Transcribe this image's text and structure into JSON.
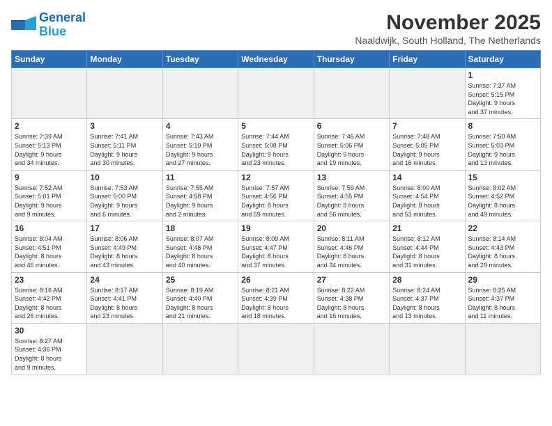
{
  "logo": {
    "line1": "General",
    "line2": "Blue"
  },
  "title": "November 2025",
  "subtitle": "Naaldwijk, South Holland, The Netherlands",
  "days_header": [
    "Sunday",
    "Monday",
    "Tuesday",
    "Wednesday",
    "Thursday",
    "Friday",
    "Saturday"
  ],
  "weeks": [
    [
      {
        "day": "",
        "info": "",
        "empty": true
      },
      {
        "day": "",
        "info": "",
        "empty": true
      },
      {
        "day": "",
        "info": "",
        "empty": true
      },
      {
        "day": "",
        "info": "",
        "empty": true
      },
      {
        "day": "",
        "info": "",
        "empty": true
      },
      {
        "day": "",
        "info": "",
        "empty": true
      },
      {
        "day": "1",
        "info": "Sunrise: 7:37 AM\nSunset: 5:15 PM\nDaylight: 9 hours\nand 37 minutes."
      }
    ],
    [
      {
        "day": "2",
        "info": "Sunrise: 7:39 AM\nSunset: 5:13 PM\nDaylight: 9 hours\nand 34 minutes."
      },
      {
        "day": "3",
        "info": "Sunrise: 7:41 AM\nSunset: 5:11 PM\nDaylight: 9 hours\nand 30 minutes."
      },
      {
        "day": "4",
        "info": "Sunrise: 7:43 AM\nSunset: 5:10 PM\nDaylight: 9 hours\nand 27 minutes."
      },
      {
        "day": "5",
        "info": "Sunrise: 7:44 AM\nSunset: 5:08 PM\nDaylight: 9 hours\nand 23 minutes."
      },
      {
        "day": "6",
        "info": "Sunrise: 7:46 AM\nSunset: 5:06 PM\nDaylight: 9 hours\nand 19 minutes."
      },
      {
        "day": "7",
        "info": "Sunrise: 7:48 AM\nSunset: 5:05 PM\nDaylight: 9 hours\nand 16 minutes."
      },
      {
        "day": "8",
        "info": "Sunrise: 7:50 AM\nSunset: 5:03 PM\nDaylight: 9 hours\nand 13 minutes."
      }
    ],
    [
      {
        "day": "9",
        "info": "Sunrise: 7:52 AM\nSunset: 5:01 PM\nDaylight: 9 hours\nand 9 minutes."
      },
      {
        "day": "10",
        "info": "Sunrise: 7:53 AM\nSunset: 5:00 PM\nDaylight: 9 hours\nand 6 minutes."
      },
      {
        "day": "11",
        "info": "Sunrise: 7:55 AM\nSunset: 4:58 PM\nDaylight: 9 hours\nand 2 minutes."
      },
      {
        "day": "12",
        "info": "Sunrise: 7:57 AM\nSunset: 4:56 PM\nDaylight: 8 hours\nand 59 minutes."
      },
      {
        "day": "13",
        "info": "Sunrise: 7:59 AM\nSunset: 4:55 PM\nDaylight: 8 hours\nand 56 minutes."
      },
      {
        "day": "14",
        "info": "Sunrise: 8:00 AM\nSunset: 4:54 PM\nDaylight: 8 hours\nand 53 minutes."
      },
      {
        "day": "15",
        "info": "Sunrise: 8:02 AM\nSunset: 4:52 PM\nDaylight: 8 hours\nand 49 minutes."
      }
    ],
    [
      {
        "day": "16",
        "info": "Sunrise: 8:04 AM\nSunset: 4:51 PM\nDaylight: 8 hours\nand 46 minutes."
      },
      {
        "day": "17",
        "info": "Sunrise: 8:06 AM\nSunset: 4:49 PM\nDaylight: 8 hours\nand 43 minutes."
      },
      {
        "day": "18",
        "info": "Sunrise: 8:07 AM\nSunset: 4:48 PM\nDaylight: 8 hours\nand 40 minutes."
      },
      {
        "day": "19",
        "info": "Sunrise: 8:09 AM\nSunset: 4:47 PM\nDaylight: 8 hours\nand 37 minutes."
      },
      {
        "day": "20",
        "info": "Sunrise: 8:11 AM\nSunset: 4:46 PM\nDaylight: 8 hours\nand 34 minutes."
      },
      {
        "day": "21",
        "info": "Sunrise: 8:12 AM\nSunset: 4:44 PM\nDaylight: 8 hours\nand 31 minutes."
      },
      {
        "day": "22",
        "info": "Sunrise: 8:14 AM\nSunset: 4:43 PM\nDaylight: 8 hours\nand 29 minutes."
      }
    ],
    [
      {
        "day": "23",
        "info": "Sunrise: 8:16 AM\nSunset: 4:42 PM\nDaylight: 8 hours\nand 26 minutes."
      },
      {
        "day": "24",
        "info": "Sunrise: 8:17 AM\nSunset: 4:41 PM\nDaylight: 8 hours\nand 23 minutes."
      },
      {
        "day": "25",
        "info": "Sunrise: 8:19 AM\nSunset: 4:40 PM\nDaylight: 8 hours\nand 21 minutes."
      },
      {
        "day": "26",
        "info": "Sunrise: 8:21 AM\nSunset: 4:39 PM\nDaylight: 8 hours\nand 18 minutes."
      },
      {
        "day": "27",
        "info": "Sunrise: 8:22 AM\nSunset: 4:38 PM\nDaylight: 8 hours\nand 16 minutes."
      },
      {
        "day": "28",
        "info": "Sunrise: 8:24 AM\nSunset: 4:37 PM\nDaylight: 8 hours\nand 13 minutes."
      },
      {
        "day": "29",
        "info": "Sunrise: 8:25 AM\nSunset: 4:37 PM\nDaylight: 8 hours\nand 11 minutes."
      }
    ],
    [
      {
        "day": "30",
        "info": "Sunrise: 8:27 AM\nSunset: 4:36 PM\nDaylight: 8 hours\nand 9 minutes.",
        "last": true
      },
      {
        "day": "",
        "info": "",
        "empty": true,
        "last": true
      },
      {
        "day": "",
        "info": "",
        "empty": true,
        "last": true
      },
      {
        "day": "",
        "info": "",
        "empty": true,
        "last": true
      },
      {
        "day": "",
        "info": "",
        "empty": true,
        "last": true
      },
      {
        "day": "",
        "info": "",
        "empty": true,
        "last": true
      },
      {
        "day": "",
        "info": "",
        "empty": true,
        "last": true
      }
    ]
  ]
}
